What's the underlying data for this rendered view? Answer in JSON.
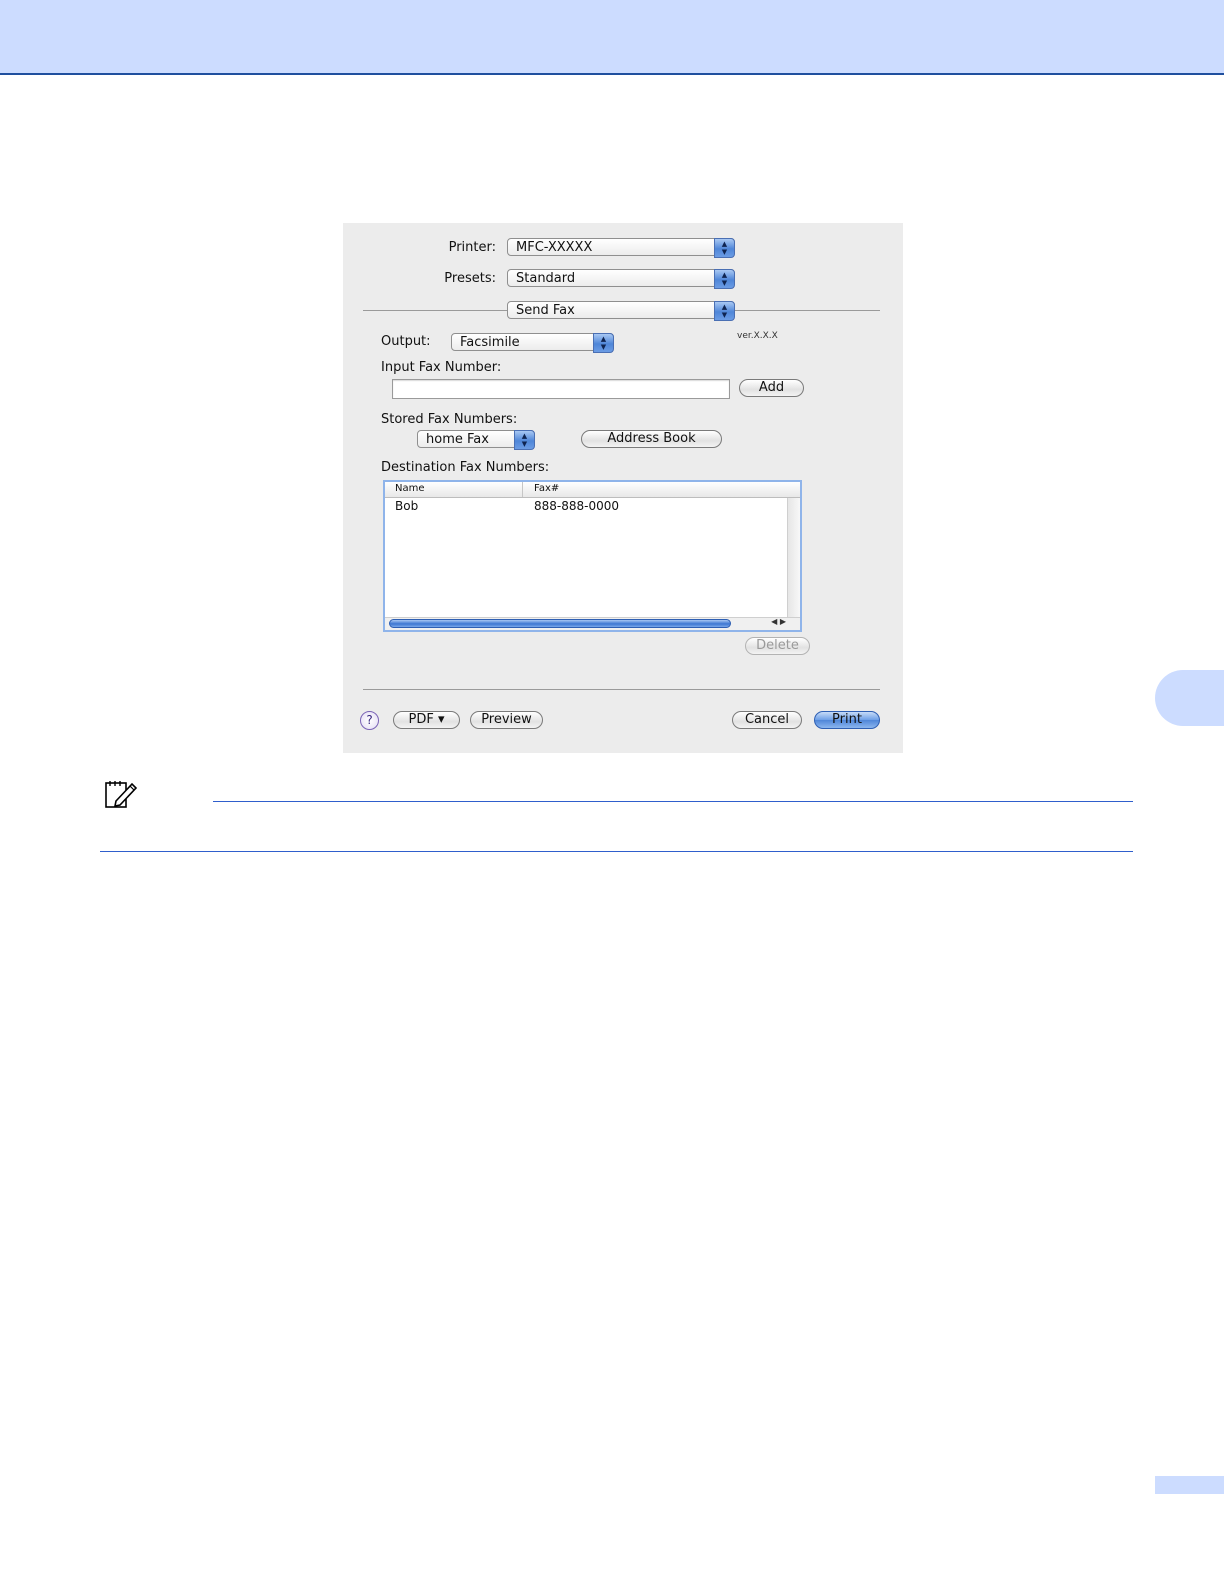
{
  "dialog": {
    "printer_label": "Printer:",
    "printer_value": "MFC-XXXXX",
    "presets_label": "Presets:",
    "presets_value": "Standard",
    "pane_value": "Send Fax",
    "output_label": "Output:",
    "output_value": "Facsimile",
    "version_text": "ver.X.X.X",
    "input_fax_label": "Input Fax Number:",
    "input_fax_value": "",
    "add_button": "Add",
    "stored_label": "Stored Fax Numbers:",
    "stored_value": "home Fax",
    "address_book_button": "Address Book",
    "destination_label": "Destination Fax Numbers:",
    "table": {
      "columns": [
        "Name",
        "Fax#"
      ],
      "rows": [
        {
          "name": "Bob",
          "fax": "888-888-0000"
        }
      ]
    },
    "delete_button": "Delete",
    "help_glyph": "?",
    "pdf_button": "PDF ▾",
    "preview_button": "Preview",
    "cancel_button": "Cancel",
    "print_button": "Print"
  },
  "colors": {
    "header_band": "#ccdcff",
    "header_rule": "#1f4f9e",
    "note_rule": "#2f5ecc",
    "dialog_bg": "#ececec",
    "accent_blue": "#4f86d8"
  }
}
